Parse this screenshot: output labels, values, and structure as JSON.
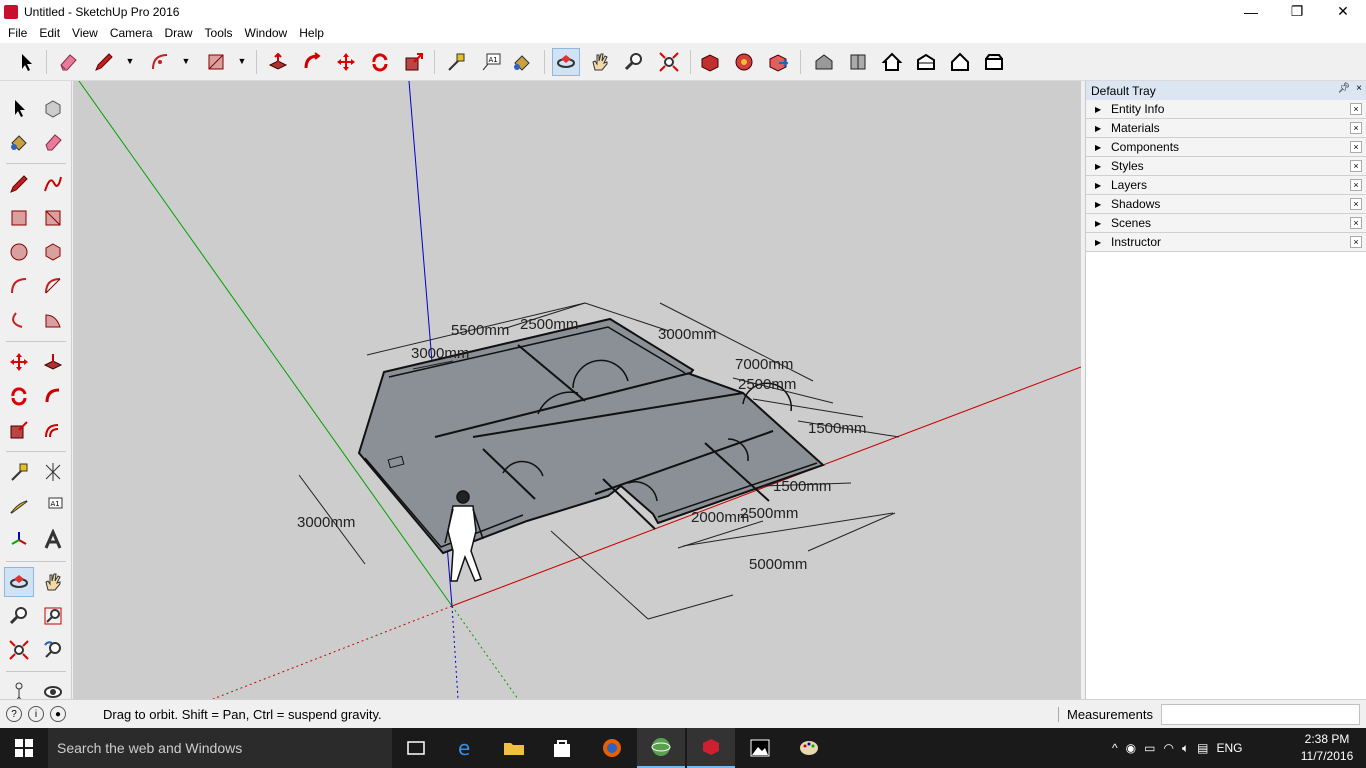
{
  "window": {
    "title": "Untitled - SketchUp Pro 2016",
    "minimize": "—",
    "maximize": "❐",
    "close": "✕"
  },
  "menu": [
    "File",
    "Edit",
    "View",
    "Camera",
    "Draw",
    "Tools",
    "Window",
    "Help"
  ],
  "toolbar": {
    "active_tool": "orbit-tool"
  },
  "viewport": {
    "background": "#cdcdcd",
    "dimensions": {
      "d1": "5500mm",
      "d2": "2500mm",
      "d3": "3000mm",
      "d4": "3000mm",
      "d5": "7000mm",
      "d6": "2500mm",
      "d7": "1500mm",
      "d8": "3000mm",
      "d9": "1500mm",
      "d10": "2000mm",
      "d11": "2500mm",
      "d12": "5000mm"
    },
    "axis_colors": {
      "red": "#cc0000",
      "green": "#00a000",
      "blue": "#0000cc"
    }
  },
  "tray": {
    "title": "Default Tray",
    "panels": [
      "Entity Info",
      "Materials",
      "Components",
      "Styles",
      "Layers",
      "Shadows",
      "Scenes",
      "Instructor"
    ],
    "close_glyph": "×"
  },
  "status": {
    "hint": "Drag to orbit. Shift = Pan, Ctrl = suspend gravity.",
    "measurements_label": "Measurements"
  },
  "taskbar": {
    "search_placeholder": "Search the web and Windows",
    "language": "ENG",
    "time": "2:38 PM",
    "date": "11/7/2016"
  }
}
